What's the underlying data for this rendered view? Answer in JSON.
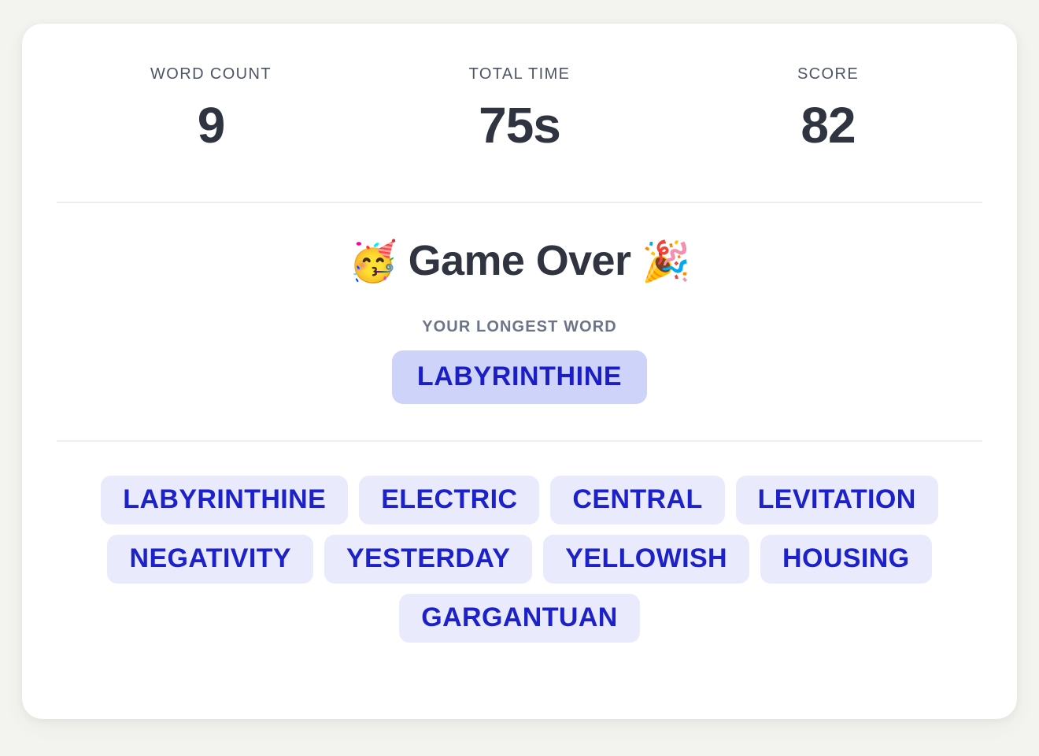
{
  "page": {
    "background_color": "#f3f3ef",
    "card_background": "#ffffff"
  },
  "stats": [
    {
      "label": "WORD COUNT",
      "value": "9"
    },
    {
      "label": "TOTAL TIME",
      "value": "75s"
    },
    {
      "label": "SCORE",
      "value": "82"
    }
  ],
  "gameover": {
    "emoji_left": "🥳",
    "title": "Game Over",
    "emoji_right": "🎉",
    "longest_label": "YOUR LONGEST WORD",
    "longest_word": "LABYRINTHINE",
    "longest_pill_bg": "#ced3f9",
    "longest_pill_text_color": "#1a1ec4"
  },
  "words": {
    "chip_bg": "#e9ebfc",
    "chip_text_color": "#1c21c9",
    "items": [
      "LABYRINTHINE",
      "ELECTRIC",
      "CENTRAL",
      "LEVITATION",
      "NEGATIVITY",
      "YESTERDAY",
      "YELLOWISH",
      "HOUSING",
      "GARGANTUAN"
    ]
  }
}
